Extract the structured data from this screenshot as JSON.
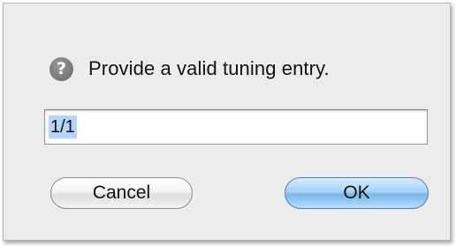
{
  "dialog": {
    "message": "Provide a valid tuning entry.",
    "icon": "question-mark-icon",
    "icon_glyph": "?",
    "entry_value": "1/1",
    "cancel_label": "Cancel",
    "ok_label": "OK"
  },
  "colors": {
    "dialog_background": "#ececec",
    "selection_highlight": "#b5d5ff",
    "default_button": "#79b6ec"
  }
}
